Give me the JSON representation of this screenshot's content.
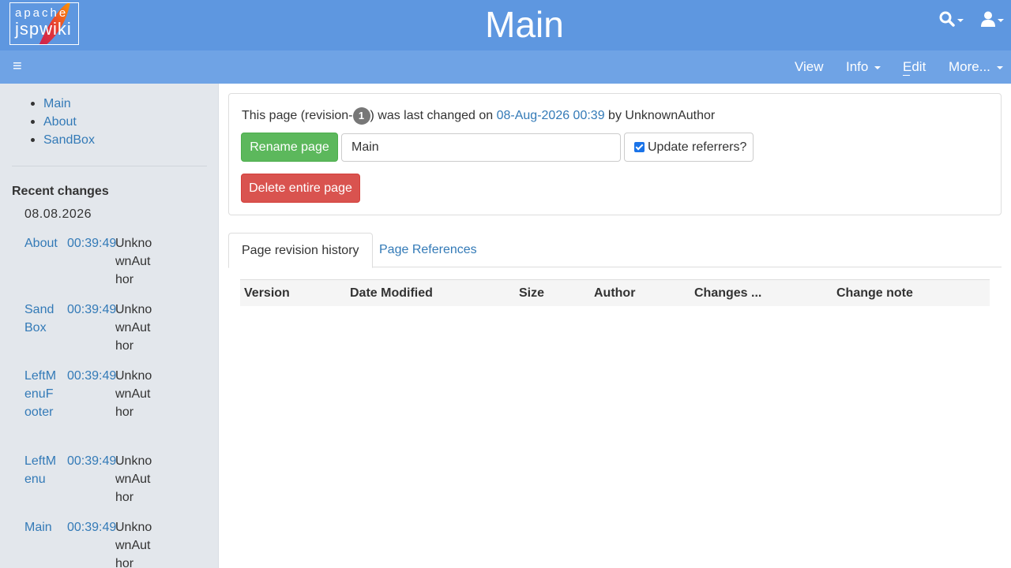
{
  "header": {
    "logo_line1": "apache",
    "logo_line2": "jspwiki",
    "title": "Main"
  },
  "navbar": {
    "menu_icon": "≡",
    "items": [
      {
        "label": "View"
      },
      {
        "label": "Info"
      },
      {
        "label": "Edit"
      },
      {
        "label": "More..."
      }
    ]
  },
  "sidebar": {
    "links": [
      "Main",
      "About",
      "SandBox"
    ],
    "recent_title": "Recent changes",
    "recent_date": "08.08.2026",
    "recent": [
      {
        "page": "About",
        "time": "00:39:49",
        "author": "UnknownAuthor"
      },
      {
        "page": "SandBox",
        "time": "00:39:49",
        "author": "UnknownAuthor"
      },
      {
        "page": "LeftMenuFooter",
        "time": "00:39:49",
        "author": "UnknownAuthor"
      },
      {
        "page": "LeftMenu",
        "time": "00:39:49",
        "author": "UnknownAuthor"
      },
      {
        "page": "Main",
        "time": "00:39:49",
        "author": "UnknownAuthor"
      }
    ]
  },
  "info": {
    "prefix": "This page (revision-",
    "revision": "1",
    "middle": ") was last changed on ",
    "date": "08-Aug-2026 00:39",
    "suffix": " by UnknownAuthor",
    "rename_label": "Rename page",
    "rename_value": "Main",
    "update_referrers_label": "Update referrers?",
    "delete_label": "Delete entire page"
  },
  "tabs": [
    {
      "label": "Page revision history",
      "active": true
    },
    {
      "label": "Page References",
      "active": false
    }
  ],
  "table": {
    "columns": [
      "Version",
      "Date Modified",
      "Size",
      "Author",
      "Changes ...",
      "Change note"
    ]
  },
  "colors": {
    "header_bg": "#5e97e0",
    "navbar_bg": "#6fa3e5",
    "sidebar_bg": "#e3e7ec",
    "rename_btn": "#5cb85c",
    "delete_btn": "#d9534f",
    "link": "#337ab7"
  }
}
